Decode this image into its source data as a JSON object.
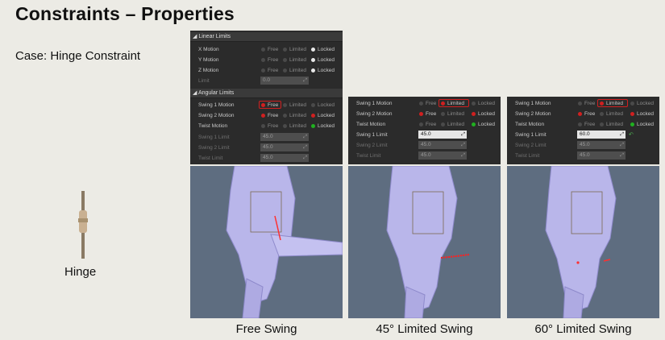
{
  "slide": {
    "title": "Constraints – Properties",
    "case_label": "Case: Hinge Constraint",
    "hinge_label": "Hinge"
  },
  "main_panel": {
    "linear_header": "Linear Limits",
    "linear_rows": [
      {
        "label": "X Motion",
        "free": "Free",
        "limited": "Limited",
        "locked": "Locked"
      },
      {
        "label": "Y Motion",
        "free": "Free",
        "limited": "Limited",
        "locked": "Locked"
      },
      {
        "label": "Z Motion",
        "free": "Free",
        "limited": "Limited",
        "locked": "Locked"
      }
    ],
    "limit_label": "Limit",
    "limit_value": "0.0",
    "angular_header": "Angular Limits",
    "angular_rows": [
      {
        "label": "Swing 1 Motion",
        "free": "Free",
        "limited": "Limited",
        "locked": "Locked"
      },
      {
        "label": "Swing 2 Motion",
        "free": "Free",
        "limited": "Limited",
        "locked": "Locked"
      },
      {
        "label": "Twist Motion",
        "free": "Free",
        "limited": "Limited",
        "locked": "Locked"
      }
    ],
    "angular_limits": [
      {
        "label": "Swing 1 Limit",
        "value": "45.0"
      },
      {
        "label": "Swing 2 Limit",
        "value": "45.0"
      },
      {
        "label": "Twist Limit",
        "value": "45.0"
      }
    ]
  },
  "panel_45": {
    "rows": [
      {
        "label": "Swing 1 Motion",
        "free": "Free",
        "limited": "Limited",
        "locked": "Locked"
      },
      {
        "label": "Swing 2 Motion",
        "free": "Free",
        "limited": "Limited",
        "locked": "Locked"
      },
      {
        "label": "Twist Motion",
        "free": "Free",
        "limited": "Limited",
        "locked": "Locked"
      }
    ],
    "limits": [
      {
        "label": "Swing 1 Limit",
        "value": "45.0"
      },
      {
        "label": "Swing 2 Limit",
        "value": "45.0"
      },
      {
        "label": "Twist Limit",
        "value": "45.0"
      }
    ]
  },
  "panel_60": {
    "rows": [
      {
        "label": "Swing 1 Motion",
        "free": "Free",
        "limited": "Limited",
        "locked": "Locked"
      },
      {
        "label": "Swing 2 Motion",
        "free": "Free",
        "limited": "Limited",
        "locked": "Locked"
      },
      {
        "label": "Twist Motion",
        "free": "Free",
        "limited": "Limited",
        "locked": "Locked"
      }
    ],
    "limits": [
      {
        "label": "Swing 1 Limit",
        "value": "60.0"
      },
      {
        "label": "Swing 2 Limit",
        "value": "45.0"
      },
      {
        "label": "Twist Limit",
        "value": "45.0"
      }
    ]
  },
  "captions": {
    "free": "Free Swing",
    "limited45": "45° Limited Swing",
    "limited60": "60° Limited Swing"
  },
  "icons": {
    "expand": "triangle-expand-icon",
    "spin_arrows": "spin-arrows-icon",
    "reset": "reset-arrow-icon"
  },
  "colors": {
    "panel_bg": "#2b2b2b",
    "locked_dot": "#e8e8e8",
    "free_dot": "#d02020",
    "limited_dot": "#d02020",
    "twist_locked_dot": "#20b020",
    "viewport_bg": "#5e6d80"
  }
}
